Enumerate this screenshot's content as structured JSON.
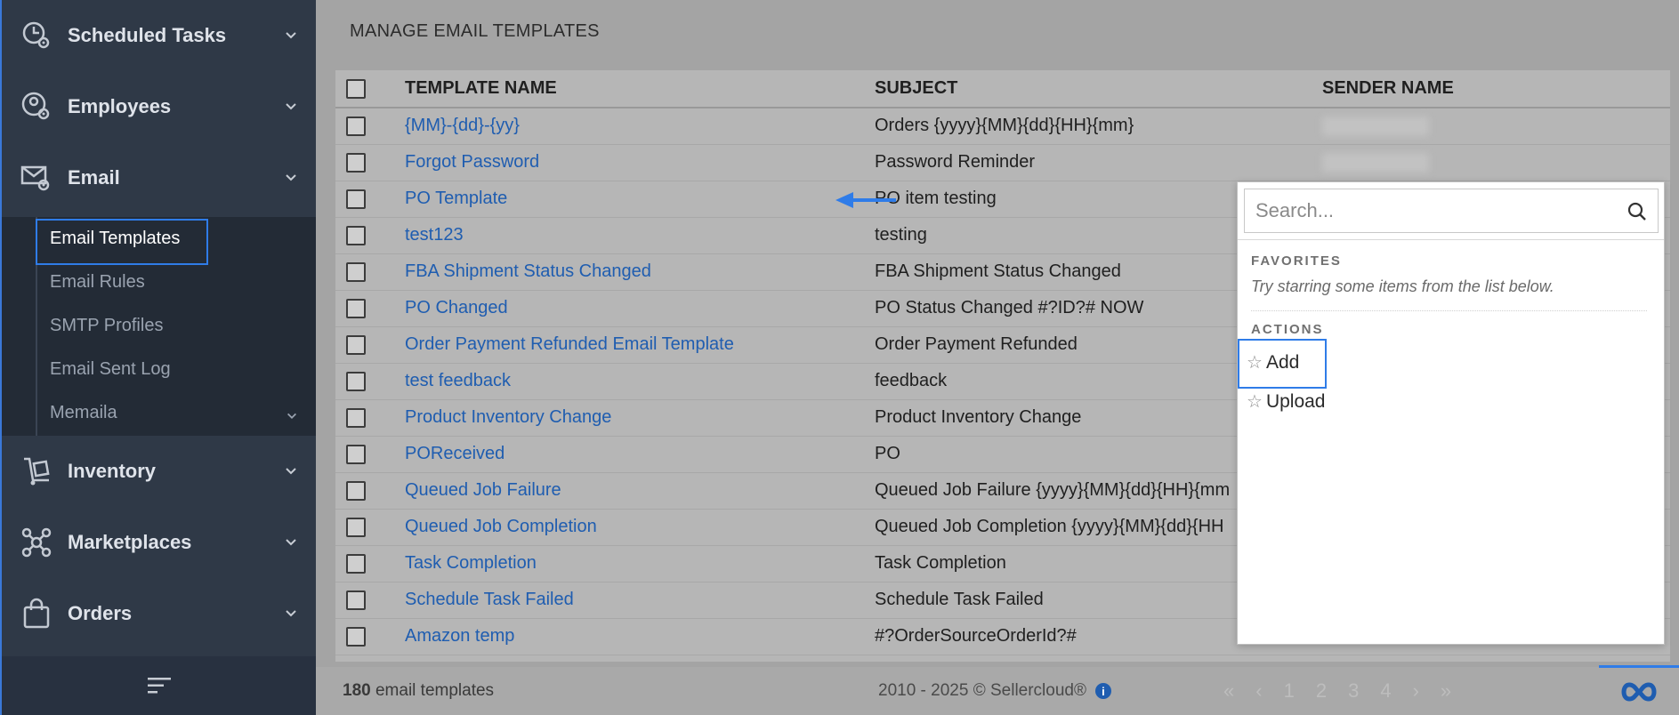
{
  "sidebar": {
    "groups_top": [
      {
        "label": "Scheduled Tasks",
        "icon": "clock-gear-icon"
      },
      {
        "label": "Employees",
        "icon": "user-gear-icon"
      },
      {
        "label": "Email",
        "icon": "envelope-gear-icon"
      }
    ],
    "email_sub": [
      {
        "label": "Email Templates",
        "active": true
      },
      {
        "label": "Email Rules"
      },
      {
        "label": "SMTP Profiles"
      },
      {
        "label": "Email Sent Log"
      },
      {
        "label": "Memaila"
      }
    ],
    "groups_bottom": [
      {
        "label": "Inventory",
        "icon": "dolly-icon"
      },
      {
        "label": "Marketplaces",
        "icon": "network-icon"
      },
      {
        "label": "Orders",
        "icon": "shopping-bag-icon"
      }
    ]
  },
  "main": {
    "title": "MANAGE EMAIL TEMPLATES",
    "columns": [
      "TEMPLATE NAME",
      "SUBJECT",
      "SENDER NAME"
    ],
    "rows": [
      {
        "name": "{MM}-{dd}-{yy}",
        "subject": "Orders {yyyy}{MM}{dd}{HH}{mm}"
      },
      {
        "name": "Forgot Password",
        "subject": "Password Reminder"
      },
      {
        "name": "PO Template",
        "subject": "PO item testing"
      },
      {
        "name": "test123",
        "subject": "testing"
      },
      {
        "name": "FBA Shipment Status Changed",
        "subject": "FBA Shipment Status Changed"
      },
      {
        "name": "PO Changed",
        "subject": "PO Status Changed #?ID?# NOW"
      },
      {
        "name": "Order Payment Refunded Email Template",
        "subject": "Order Payment Refunded"
      },
      {
        "name": "test feedback",
        "subject": "feedback"
      },
      {
        "name": "Product Inventory Change",
        "subject": "Product Inventory Change"
      },
      {
        "name": "POReceived",
        "subject": "PO"
      },
      {
        "name": "Queued Job Failure",
        "subject": "Queued Job Failure {yyyy}{MM}{dd}{HH}{mm"
      },
      {
        "name": "Queued Job Completion",
        "subject": "Queued Job Completion {yyyy}{MM}{dd}{HH"
      },
      {
        "name": "Task Completion",
        "subject": "Task Completion"
      },
      {
        "name": "Schedule Task Failed",
        "subject": "Schedule Task Failed"
      },
      {
        "name": "Amazon temp",
        "subject": "#?OrderSourceOrderId?#"
      }
    ]
  },
  "footer": {
    "count_number": "180",
    "count_label": "email templates",
    "copyright": "2010 - 2025 © Sellercloud®",
    "pages": [
      "1",
      "2",
      "3",
      "4"
    ]
  },
  "dropdown": {
    "search_placeholder": "Search...",
    "favorites_label": "FAVORITES",
    "favorites_hint": "Try starring some items from the list below.",
    "actions_label": "ACTIONS",
    "actions": [
      "Add",
      "Upload"
    ]
  },
  "colors": {
    "accent": "#2f7ce8",
    "sidebar_bg": "#2f3947",
    "link": "#1f5db0"
  }
}
